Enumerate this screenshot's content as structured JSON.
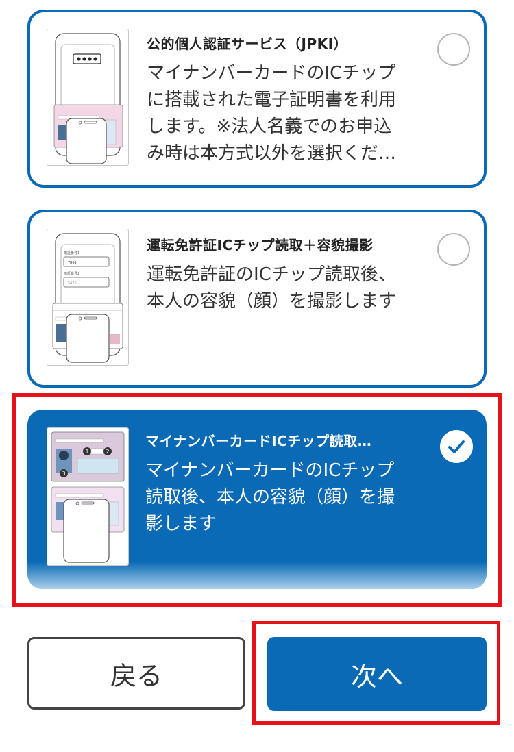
{
  "options": [
    {
      "title": "公的個人認証サービス（JPKI）",
      "description": "マイナンバーカードのICチップに搭載された電子証明書を利用します。※法人名義でのお申込み時は本方式以外を選択くだ…",
      "desc_lines": [
        "マイナンバーカードのICチップ",
        "に搭載された電子証明書を利用",
        "します。※法人名義でのお申込",
        "み時は本方式以外を選択くだ…"
      ],
      "selected": false,
      "icon": "mynumber-card-phone-illustration"
    },
    {
      "title": "運転免許証ICチップ読取＋容貌撮影",
      "desc_lines": [
        "運転免許証のICチップ読取後、",
        "本人の容貌（顔）を撮影します"
      ],
      "selected": false,
      "icon": "drivers-license-phone-illustration",
      "thumb_text": [
        "暗証番号1",
        "7865",
        "暗証番号2",
        "5470"
      ]
    },
    {
      "title": "マイナンバーカードICチップ読取…",
      "desc_lines": [
        "マイナンバーカードのICチップ",
        "読取後、本人の容貌（顔）を撮",
        "影します"
      ],
      "selected": true,
      "icon": "mynumber-card-ic-read-illustration"
    }
  ],
  "buttons": {
    "back": "戻る",
    "next": "次へ"
  },
  "colors": {
    "accent": "#0a6ab5",
    "highlight": "#e6121a"
  }
}
